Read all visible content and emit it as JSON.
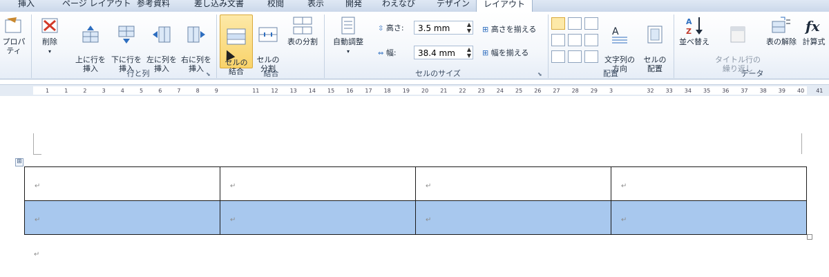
{
  "tabs": [
    "挿入",
    "ページ レイアウト",
    "参考資料",
    "差し込み文書",
    "校閲",
    "表示",
    "開発",
    "わえなび",
    "デザイン",
    "レイアウト"
  ],
  "ribbon": {
    "table_group": {
      "properties_label": "プロパティ"
    },
    "rows_cols": {
      "delete_label": "削除",
      "insert_above": "上に行を\n挿入",
      "insert_below": "下に行を\n挿入",
      "insert_left": "左に列を\n挿入",
      "insert_right": "右に列を\n挿入",
      "group_label": "行と列"
    },
    "merge": {
      "merge_cells": "セルの\n結合",
      "split_cells": "セルの\n分割",
      "split_table": "表の分割",
      "group_label": "結合"
    },
    "cell_size": {
      "autofit": "自動調整",
      "height_label": "高さ:",
      "height_value": "3.5 mm",
      "width_label": "幅:",
      "width_value": "38.4 mm",
      "distribute_rows": "高さを揃える",
      "distribute_cols": "幅を揃える",
      "group_label": "セルのサイズ"
    },
    "alignment": {
      "text_direction": "文字列の\n方向",
      "cell_margins": "セルの\n配置",
      "group_label": "配置"
    },
    "data": {
      "sort": "並べ替え",
      "repeat_header": "タイトル行の\n繰り返し",
      "convert_to_text": "表の解除",
      "formula": "計算式",
      "group_label": "データ"
    }
  },
  "ruler": {
    "numbers": [
      "1",
      "1",
      "2",
      "3",
      "4",
      "5",
      "6",
      "7",
      "8",
      "9",
      "",
      "11",
      "12",
      "13",
      "14",
      "15",
      "16",
      "17",
      "18",
      "19",
      "20",
      "21",
      "22",
      "23",
      "24",
      "25",
      "26",
      "27",
      "28",
      "29",
      "3",
      "",
      "32",
      "33",
      "34",
      "35",
      "36",
      "37",
      "38",
      "39",
      "40",
      "41"
    ]
  },
  "document": {
    "rows": [
      [
        "↵",
        "↵",
        "↵",
        "↵"
      ],
      [
        "↵",
        "↵",
        "↵",
        "↵"
      ]
    ],
    "paragraph_mark": "↵",
    "move_handle": "⊞"
  },
  "colors": {
    "selection": "#a8c8ee",
    "active_button": "#f9d36a",
    "ribbon_border": "#a9bcd4"
  }
}
